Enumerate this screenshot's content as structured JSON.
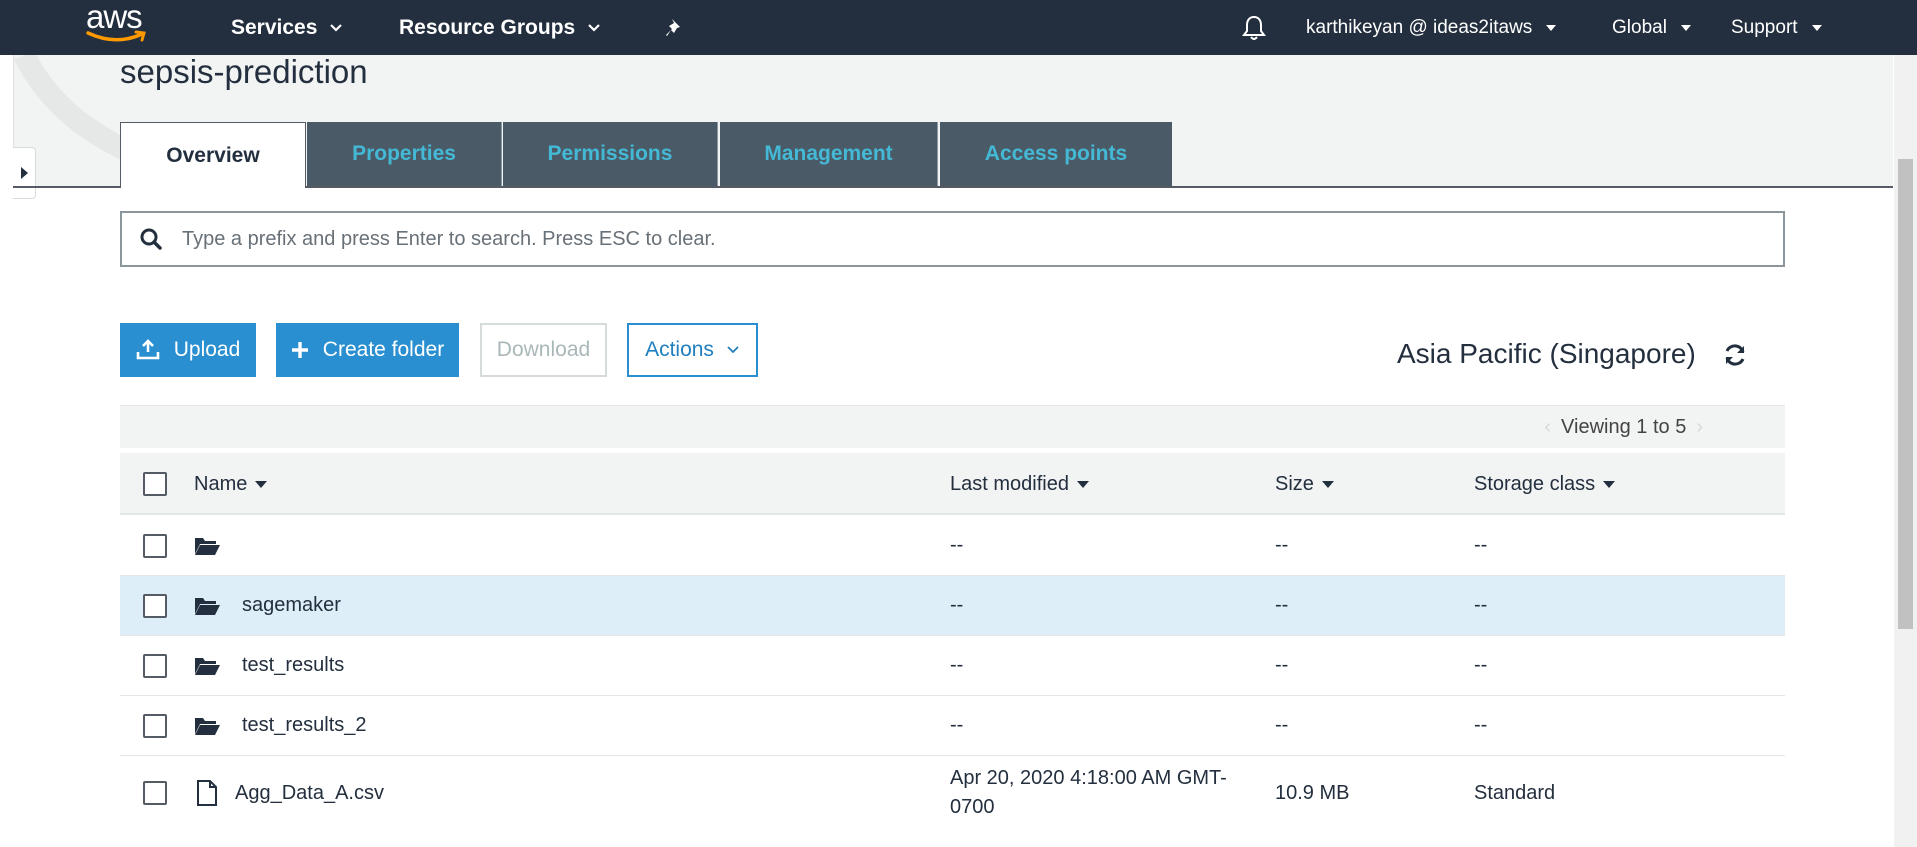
{
  "nav": {
    "logo_text": "aws",
    "services": "Services",
    "resource_groups": "Resource Groups",
    "pin_icon": "pushpin-icon",
    "bell_icon": "bell-icon",
    "user": "karthikeyan @ ideas2itaws",
    "region": "Global",
    "support": "Support"
  },
  "bucket": {
    "name": "sepsis-prediction"
  },
  "tabs": [
    {
      "label": "Overview",
      "active": true
    },
    {
      "label": "Properties"
    },
    {
      "label": "Permissions"
    },
    {
      "label": "Management"
    },
    {
      "label": "Access points"
    }
  ],
  "search": {
    "placeholder": "Type a prefix and press Enter to search. Press ESC to clear.",
    "value": ""
  },
  "toolbar": {
    "upload": "Upload",
    "create_folder": "Create folder",
    "download": "Download",
    "actions": "Actions"
  },
  "region_label": "Asia Pacific (Singapore)",
  "pager": {
    "text": "Viewing 1 to 5"
  },
  "columns": {
    "name": "Name",
    "last_modified": "Last modified",
    "size": "Size",
    "storage_class": "Storage class"
  },
  "rows": [
    {
      "type": "folder",
      "name": "",
      "last_modified": "--",
      "size": "--",
      "storage_class": "--",
      "selected": false
    },
    {
      "type": "folder",
      "name": "sagemaker",
      "last_modified": "--",
      "size": "--",
      "storage_class": "--",
      "selected": true
    },
    {
      "type": "folder",
      "name": "test_results",
      "last_modified": "--",
      "size": "--",
      "storage_class": "--",
      "selected": false
    },
    {
      "type": "folder",
      "name": "test_results_2",
      "last_modified": "--",
      "size": "--",
      "storage_class": "--",
      "selected": false
    },
    {
      "type": "file",
      "name": "Agg_Data_A.csv",
      "last_modified": "Apr 20, 2020 4:18:00 AM GMT-0700",
      "size": "10.9 MB",
      "storage_class": "Standard",
      "selected": false
    }
  ],
  "colors": {
    "nav_bg": "#232f3e",
    "primary": "#2a8fd0",
    "tab_inactive_bg": "#4a5a66",
    "tab_text": "#44b9d6",
    "selected_row": "#deeef8"
  }
}
